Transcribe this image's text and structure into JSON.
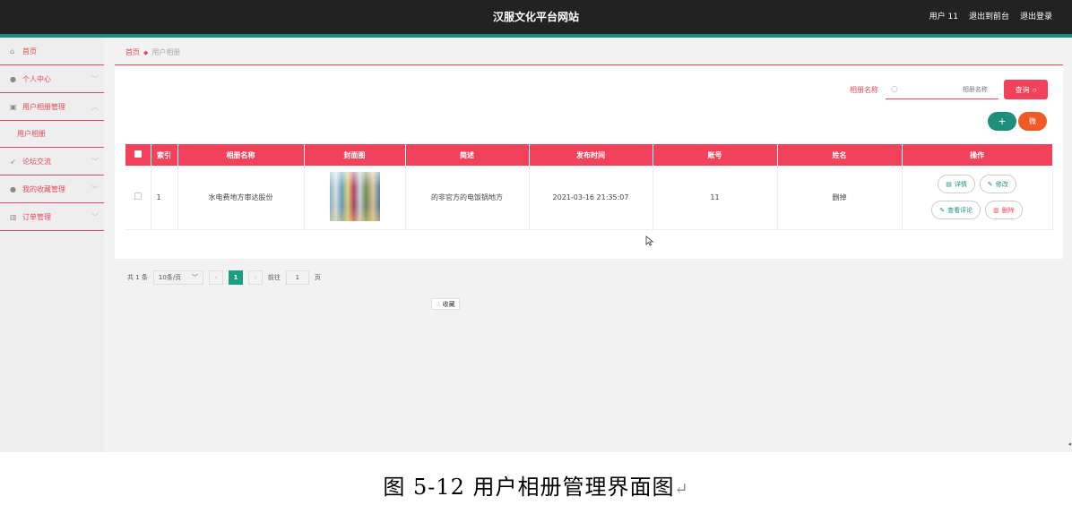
{
  "header": {
    "title": "汉服文化平台网站",
    "links": [
      "用户 11",
      "退出到前台",
      "退出登录"
    ]
  },
  "sidebar": {
    "items": [
      {
        "label": "首页",
        "icon": "home-icon"
      },
      {
        "label": "个人中心",
        "icon": "user-icon"
      },
      {
        "label": "用户相册管理",
        "icon": "album-icon",
        "expanded": true,
        "children": [
          "用户相册"
        ]
      },
      {
        "label": "论坛交流",
        "icon": "send-icon"
      },
      {
        "label": "我的收藏管理",
        "icon": "pin-icon"
      },
      {
        "label": "订单管理",
        "icon": "chart-icon"
      }
    ]
  },
  "breadcrumb": {
    "home": "首页",
    "current": "用户相册"
  },
  "search": {
    "label": "相册名称",
    "placeholder": "相册名称",
    "button": "查询"
  },
  "actions": {
    "add": "+",
    "delete": "微"
  },
  "table": {
    "columns": [
      "",
      "索引",
      "相册名称",
      "封面图",
      "简述",
      "发布时间",
      "账号",
      "姓名",
      "操作"
    ],
    "rows": [
      {
        "index": "1",
        "name": "水电费地方审达股份",
        "summary": "的非官方的电饭锅地方",
        "published": "2021-03-16 21:35:07",
        "account": "11",
        "real_name": "删掉",
        "ops": [
          "详情",
          "修改",
          "查看评论",
          "删除"
        ]
      }
    ]
  },
  "pager": {
    "total": "共 1 条",
    "page_size": "10条/页",
    "current_page": "1",
    "goto_label": "前往",
    "goto_value": "1",
    "page_suffix": "页"
  },
  "favorite": {
    "label": "收藏"
  },
  "caption": {
    "text": "图 5-12 用户相册管理界面图"
  },
  "colors": {
    "accent": "#f0425b",
    "teal": "#1d8f7c",
    "topbar": "#222222",
    "orange": "#f15a24"
  }
}
